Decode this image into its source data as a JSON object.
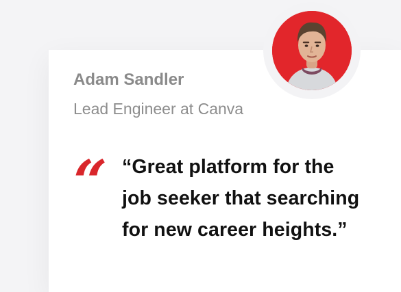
{
  "testimonial": {
    "author_name": "Adam Sandler",
    "author_role": "Lead Engineer at Canva",
    "quote_glyph": "“",
    "quote": "“Great platform for the job seeker that searching for new career heights.”",
    "avatar_icon": "person-portrait"
  },
  "colors": {
    "accent": "#d9262b",
    "avatar_background": "#e2262b",
    "name_text": "#8a8a8a",
    "quote_text": "#111111"
  }
}
